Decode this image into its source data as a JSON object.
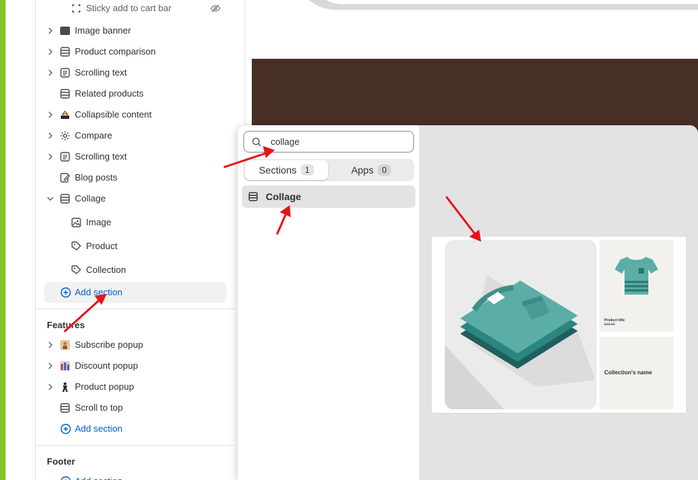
{
  "sidebar": {
    "items": [
      {
        "label": "Sticky add to cart bar",
        "icon": "sticky-bar-icon",
        "chevron": false,
        "hidden": true
      },
      {
        "label": "Image banner",
        "icon": "image-banner-icon",
        "chevron": true
      },
      {
        "label": "Product comparison",
        "icon": "section-icon",
        "chevron": true
      },
      {
        "label": "Scrolling text",
        "icon": "text-icon",
        "chevron": true
      },
      {
        "label": "Related products",
        "icon": "section-icon",
        "chevron": false
      },
      {
        "label": "Collapsible content",
        "icon": "app-thumbnail-icon",
        "chevron": true
      },
      {
        "label": "Compare",
        "icon": "gear-icon",
        "chevron": true
      },
      {
        "label": "Scrolling text",
        "icon": "text-icon",
        "chevron": true
      },
      {
        "label": "Blog posts",
        "icon": "edit-icon",
        "chevron": false
      },
      {
        "label": "Collage",
        "icon": "section-icon",
        "chevron": true,
        "expanded": true
      }
    ],
    "collage_blocks": [
      {
        "label": "Image",
        "icon": "image-icon"
      },
      {
        "label": "Product",
        "icon": "tag-icon"
      },
      {
        "label": "Collection",
        "icon": "tag-icon"
      }
    ],
    "add_section_label": "Add section",
    "features_title": "Features",
    "features_items": [
      {
        "label": "Subscribe popup",
        "icon": "app-thumbnail-icon"
      },
      {
        "label": "Discount popup",
        "icon": "app-thumbnail-icon"
      },
      {
        "label": "Product popup",
        "icon": "app-thumbnail-icon"
      },
      {
        "label": "Scroll to top",
        "icon": "section-icon"
      }
    ],
    "footer_title": "Footer"
  },
  "picker": {
    "search_value": "collage",
    "tabs": [
      {
        "label": "Sections",
        "count": "1",
        "active": true
      },
      {
        "label": "Apps",
        "count": "0",
        "active": false
      }
    ],
    "result_label": "Collage",
    "preview": {
      "product_title": "Product title",
      "product_price": "$19.99",
      "collection_name": "Collection's name"
    }
  },
  "colors": {
    "accent_bar": "#87c128",
    "link_blue": "#005bd3",
    "preview_brown": "#482f25",
    "annotation_red": "#e8141b",
    "teal": "#5aaea6"
  }
}
